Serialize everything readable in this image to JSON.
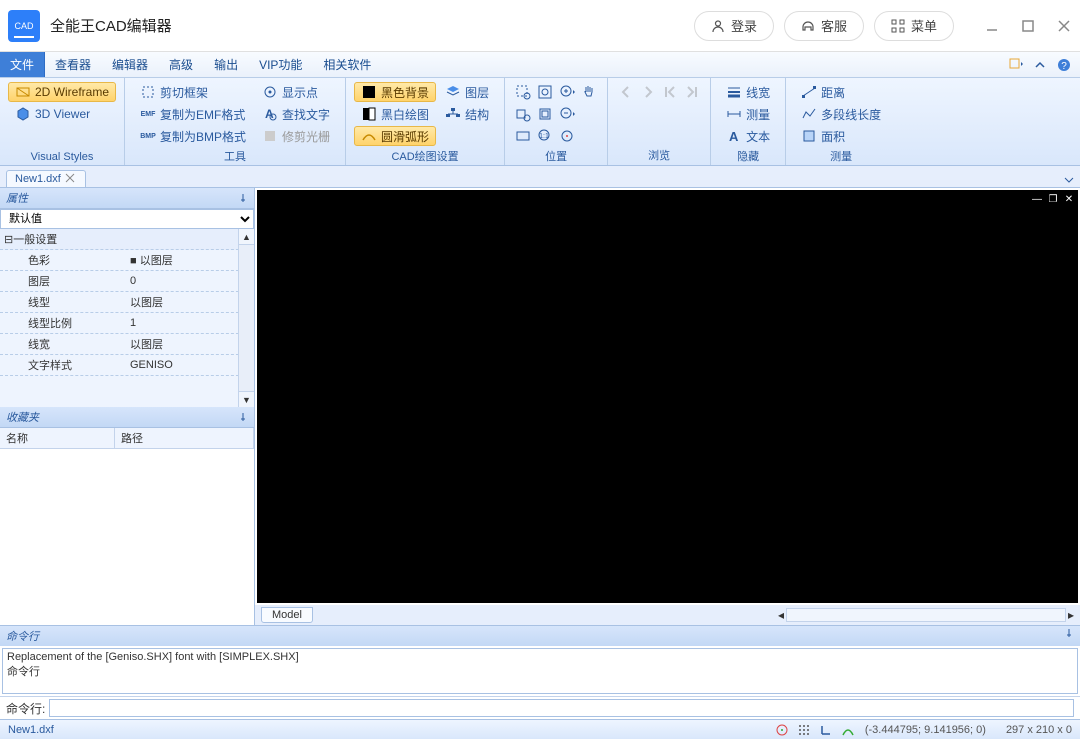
{
  "app": {
    "title": "全能王CAD编辑器",
    "logo_text": "CAD"
  },
  "titlebar_buttons": {
    "login": "登录",
    "service": "客服",
    "menu": "菜单"
  },
  "menu": {
    "items": [
      "文件",
      "查看器",
      "编辑器",
      "高级",
      "输出",
      "VIP功能",
      "相关软件"
    ],
    "active_index": 0
  },
  "ribbon": {
    "groups": [
      {
        "label": "Visual Styles",
        "items": [
          {
            "label": "2D Wireframe",
            "selected": true,
            "icon": "wireframe-icon"
          },
          {
            "label": "3D Viewer",
            "selected": false,
            "icon": "viewer3d-icon"
          }
        ]
      },
      {
        "label": "工具",
        "cols": [
          [
            {
              "label": "剪切框架",
              "icon": "cut-icon"
            },
            {
              "label": "复制为EMF格式",
              "icon": "emf-icon"
            },
            {
              "label": "复制为BMP格式",
              "icon": "bmp-icon"
            }
          ],
          [
            {
              "label": "显示点",
              "icon": "point-icon"
            },
            {
              "label": "查找文字",
              "icon": "searchtext-icon"
            },
            {
              "label": "修剪光栅",
              "icon": "trim-icon",
              "disabled": true
            }
          ]
        ]
      },
      {
        "label": "CAD绘图设置",
        "cols": [
          [
            {
              "label": "黑色背景",
              "icon": "blackbg-icon",
              "selected": true
            },
            {
              "label": "黑白绘图",
              "icon": "bwdraw-icon"
            },
            {
              "label": "圆滑弧形",
              "icon": "smootharc-icon",
              "selected": true
            }
          ],
          [
            {
              "label": "图层",
              "icon": "layer-icon"
            },
            {
              "label": "结构",
              "icon": "struct-icon"
            }
          ]
        ]
      },
      {
        "label": "位置",
        "iconrows": 3
      },
      {
        "label": "浏览",
        "iconrows": 1
      },
      {
        "label": "隐藏",
        "cols": [
          [
            {
              "label": "线宽",
              "icon": "lineweight-icon"
            },
            {
              "label": "测量",
              "icon": "measure-icon"
            },
            {
              "label": "文本",
              "icon": "text-icon"
            }
          ]
        ]
      },
      {
        "label": "测量",
        "cols": [
          [
            {
              "label": "距离",
              "icon": "distance-icon"
            },
            {
              "label": "多段线长度",
              "icon": "polyline-icon"
            },
            {
              "label": "面积",
              "icon": "area-icon"
            }
          ]
        ]
      }
    ]
  },
  "document_tab": {
    "name": "New1.dxf"
  },
  "properties": {
    "panel_title": "属性",
    "dropdown": "默认值",
    "group_label": "一般设置",
    "rows": [
      {
        "key": "色彩",
        "val": "以图层",
        "swatch": true
      },
      {
        "key": "图层",
        "val": "0"
      },
      {
        "key": "线型",
        "val": "以图层"
      },
      {
        "key": "线型比例",
        "val": "1"
      },
      {
        "key": "线宽",
        "val": "以图层"
      },
      {
        "key": "文字样式",
        "val": "GENISO"
      }
    ]
  },
  "favorites": {
    "panel_title": "收藏夹",
    "col_name": "名称",
    "col_path": "路径"
  },
  "model_tab": "Model",
  "command": {
    "panel_title": "命令行",
    "output_lines": [
      "Replacement of the [Geniso.SHX] font with [SIMPLEX.SHX]",
      "命令行"
    ],
    "prompt": "命令行:"
  },
  "statusbar": {
    "file": "New1.dxf",
    "coords": "(-3.444795; 9.141956; 0)",
    "dims": "297 x 210 x 0"
  }
}
